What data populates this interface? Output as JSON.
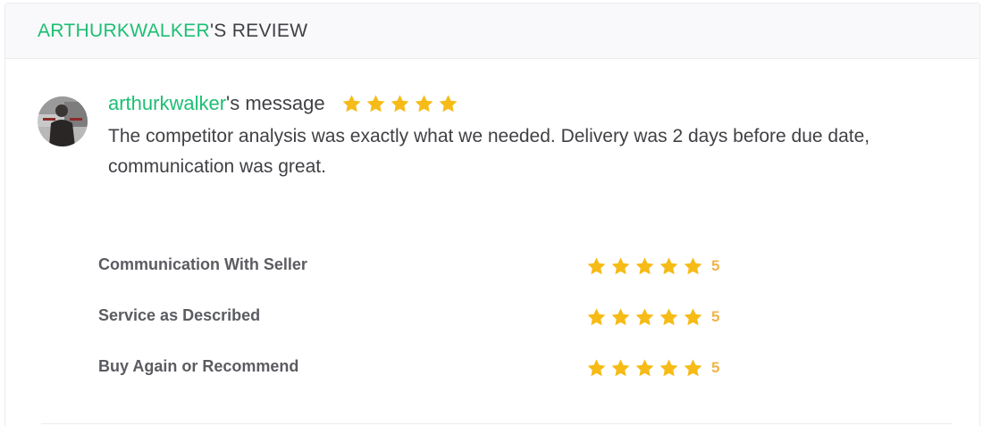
{
  "header": {
    "owner": "ARTHURKWALKER",
    "suffix": "'S REVIEW"
  },
  "message": {
    "owner": "arthurkwalker",
    "suffix": "'s message",
    "rating": 5,
    "text": "The competitor analysis was exactly what we needed. Delivery was 2 days before due date, communication was great."
  },
  "ratings": [
    {
      "label": "Communication With Seller",
      "value": "5"
    },
    {
      "label": "Service as Described",
      "value": "5"
    },
    {
      "label": "Buy Again or Recommend",
      "value": "5"
    }
  ],
  "colors": {
    "brand_green": "#1dbf73",
    "star_yellow": "#f6bb17",
    "rating_value": "#f0b44b"
  }
}
